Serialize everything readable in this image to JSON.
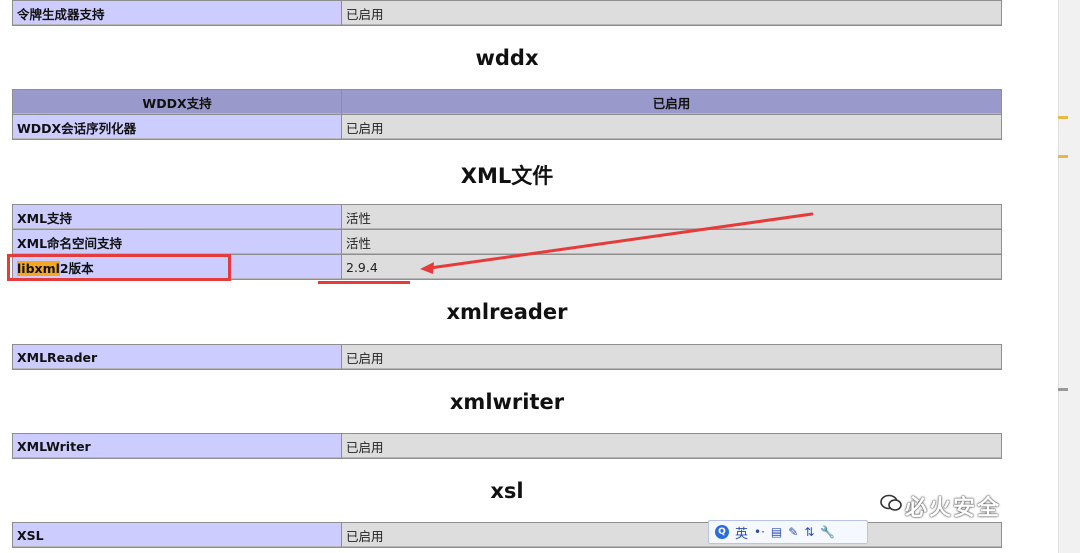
{
  "sections": {
    "top": {
      "row_label": "令牌生成器支持",
      "row_value": "已启用"
    },
    "wddx": {
      "title": "wddx",
      "header_left": "WDDX支持",
      "header_right": "已启用",
      "row_label": "WDDX会话序列化器",
      "row_value": "已启用"
    },
    "xml": {
      "title": "XML文件",
      "rows": [
        {
          "label": "XML支持",
          "value": "活性"
        },
        {
          "label": "XML命名空间支持",
          "value": "活性"
        },
        {
          "label_highlight": "libxml",
          "label_rest": "2版本",
          "value": "2.9.4"
        }
      ]
    },
    "xmlreader": {
      "title": "xmlreader",
      "row_label": "XMLReader",
      "row_value": "已启用"
    },
    "xmlwriter": {
      "title": "xmlwriter",
      "row_label": "XMLWriter",
      "row_value": "已启用"
    },
    "xsl": {
      "title": "xsl",
      "row_label": "XSL",
      "row_value": "已启用"
    }
  },
  "ime_toolbar": {
    "logo": "Q",
    "lang": "英",
    "icons": [
      "punctuation-icon",
      "keyboard-icon",
      "notepad-icon",
      "settings-icon",
      "tools-icon"
    ]
  },
  "watermark": {
    "text": "必火安全"
  },
  "colors": {
    "row_label_bg": "#ccccff",
    "row_value_bg": "#dddddd",
    "header_bg": "#9999cc",
    "annotation_red": "#e63b3b",
    "highlight_orange": "#f5a623"
  }
}
